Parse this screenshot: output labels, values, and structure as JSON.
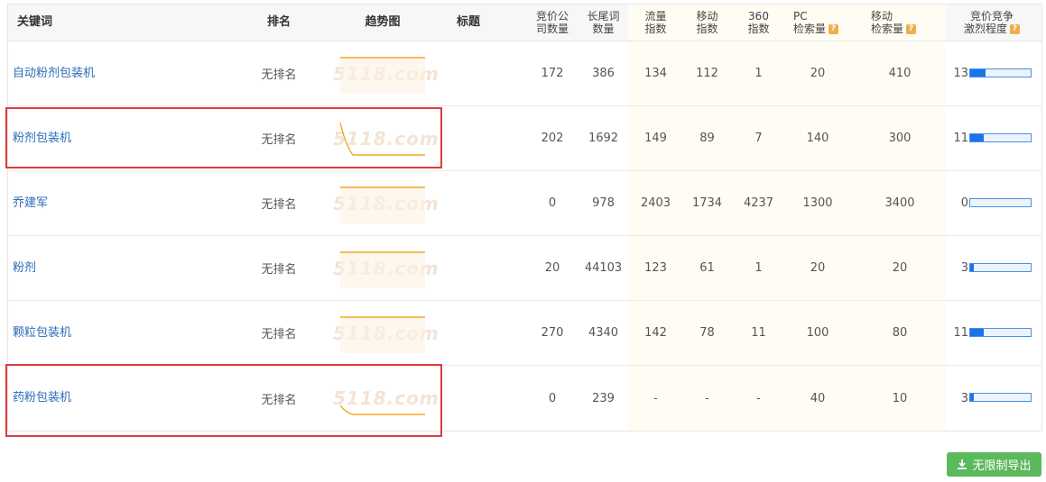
{
  "headers": {
    "keyword": "关键词",
    "rank": "排名",
    "trend": "趋势图",
    "title": "标题",
    "bid_companies": [
      "竞价公",
      "司数量"
    ],
    "longtail": [
      "长尾词",
      "数量"
    ],
    "traffic": [
      "流量",
      "指数"
    ],
    "mobile_index": [
      "移动",
      "指数"
    ],
    "index_360": [
      "360",
      "指数"
    ],
    "pc_search": [
      "PC",
      "检索量"
    ],
    "mobile_search": [
      "移动",
      "检索量"
    ],
    "competition": [
      "竞价竞争",
      "激烈程度"
    ],
    "help_glyph": "?"
  },
  "watermark": "5118.com",
  "rows": [
    {
      "keyword": "自动粉剂包装机",
      "rank": "无排名",
      "bid_companies": "172",
      "longtail": "386",
      "traffic": "134",
      "mobile_index": "112",
      "index_360": "1",
      "pc_search": "20",
      "mobile_search": "410",
      "competition": "13",
      "competition_level": 0.26,
      "trend": "flat"
    },
    {
      "keyword": "粉剂包装机",
      "rank": "无排名",
      "bid_companies": "202",
      "longtail": "1692",
      "traffic": "149",
      "mobile_index": "89",
      "index_360": "7",
      "pc_search": "140",
      "mobile_search": "300",
      "competition": "11",
      "competition_level": 0.22,
      "trend": "drop"
    },
    {
      "keyword": "乔建军",
      "rank": "无排名",
      "bid_companies": "0",
      "longtail": "978",
      "traffic": "2403",
      "mobile_index": "1734",
      "index_360": "4237",
      "pc_search": "1300",
      "mobile_search": "3400",
      "competition": "0",
      "competition_level": 0.0,
      "trend": "flat"
    },
    {
      "keyword": "粉剂",
      "rank": "无排名",
      "bid_companies": "20",
      "longtail": "44103",
      "traffic": "123",
      "mobile_index": "61",
      "index_360": "1",
      "pc_search": "20",
      "mobile_search": "20",
      "competition": "3",
      "competition_level": 0.06,
      "trend": "flat"
    },
    {
      "keyword": "颗粒包装机",
      "rank": "无排名",
      "bid_companies": "270",
      "longtail": "4340",
      "traffic": "142",
      "mobile_index": "78",
      "index_360": "11",
      "pc_search": "100",
      "mobile_search": "80",
      "competition": "11",
      "competition_level": 0.22,
      "trend": "flat"
    },
    {
      "keyword": "药粉包装机",
      "rank": "无排名",
      "bid_companies": "0",
      "longtail": "239",
      "traffic": "-",
      "mobile_index": "-",
      "index_360": "-",
      "pc_search": "40",
      "mobile_search": "10",
      "competition": "3",
      "competition_level": 0.06,
      "trend": "small-drop"
    }
  ],
  "export_button": "无限制导出",
  "colors": {
    "link": "#2b6cb7",
    "bar_fill": "#1a73e8",
    "spark": "#f5a623",
    "highlight": "#e03c3c",
    "export": "#5cb85c"
  }
}
